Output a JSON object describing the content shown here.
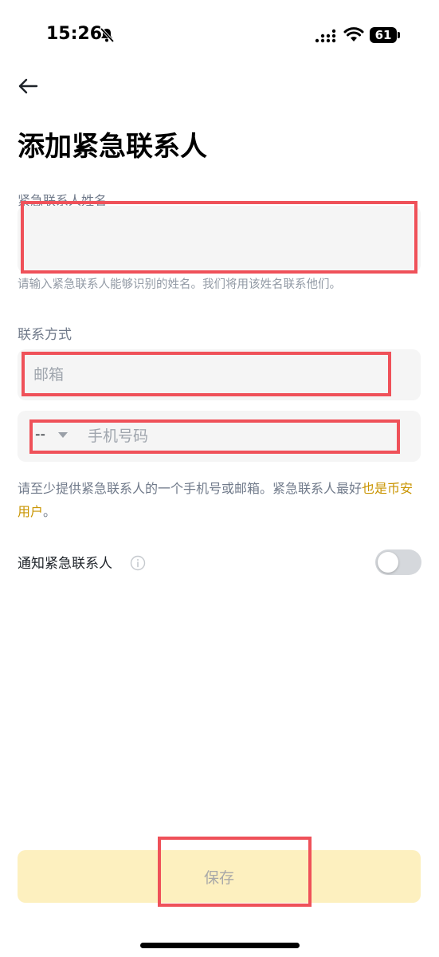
{
  "status_bar": {
    "time": "15:26",
    "battery": "61",
    "icons": [
      "bell-slash-icon",
      "signal-icon",
      "wifi-icon",
      "battery-icon"
    ]
  },
  "header": {
    "back_icon": "arrow-left-icon",
    "title": "添加紧急联系人"
  },
  "form": {
    "name": {
      "label": "紧急联系人姓名",
      "value": "",
      "hint": "请输入紧急联系人能够识别的姓名。我们将用该姓名联系他们。"
    },
    "contact": {
      "label": "联系方式",
      "email_placeholder": "邮箱",
      "country_code": "--",
      "phone_placeholder": "手机号码",
      "hint_prefix": "请至少提供紧急联系人的一个手机号或邮箱。紧急联系人最好",
      "hint_link": "也是币安用户",
      "hint_suffix": "。"
    },
    "notify": {
      "label": "通知紧急联系人",
      "enabled": false
    }
  },
  "actions": {
    "save_label": "保存"
  },
  "colors": {
    "accent_link": "#c99400",
    "save_button_bg": "#fdf0bf",
    "annotation_red": "#ef5159"
  }
}
